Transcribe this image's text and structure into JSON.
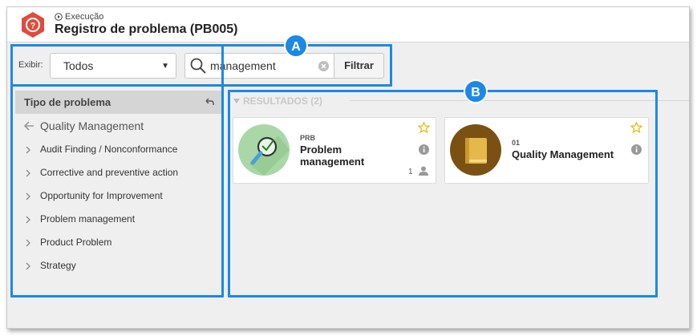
{
  "header": {
    "breadcrumb": "Execução",
    "title": "Registro de problema (PB005)"
  },
  "filters": {
    "show_label": "Exibir:",
    "show_value": "Todos",
    "search_value": "management",
    "filter_button": "Filtrar"
  },
  "sidebar": {
    "title": "Tipo de problema",
    "back_label": "Quality Management",
    "items": [
      {
        "label": "Audit Finding / Nonconformance"
      },
      {
        "label": "Corrective and preventive action"
      },
      {
        "label": "Opportunity for Improvement"
      },
      {
        "label": "Problem management"
      },
      {
        "label": "Product Problem"
      },
      {
        "label": "Strategy"
      }
    ]
  },
  "results": {
    "title": "RESULTADOS (2)",
    "cards": [
      {
        "code": "PRB",
        "name_line1": "Problem",
        "name_line2": "management",
        "count": "1",
        "icon": "magnifier-chart-icon"
      },
      {
        "code": "01",
        "name_line1": "Quality Management",
        "icon": "book-icon"
      }
    ]
  },
  "annotations": {
    "a": "A",
    "b": "B"
  },
  "colors": {
    "accent": "#1e88e5",
    "star": "#e6b800",
    "logo": "#e04b3c"
  }
}
